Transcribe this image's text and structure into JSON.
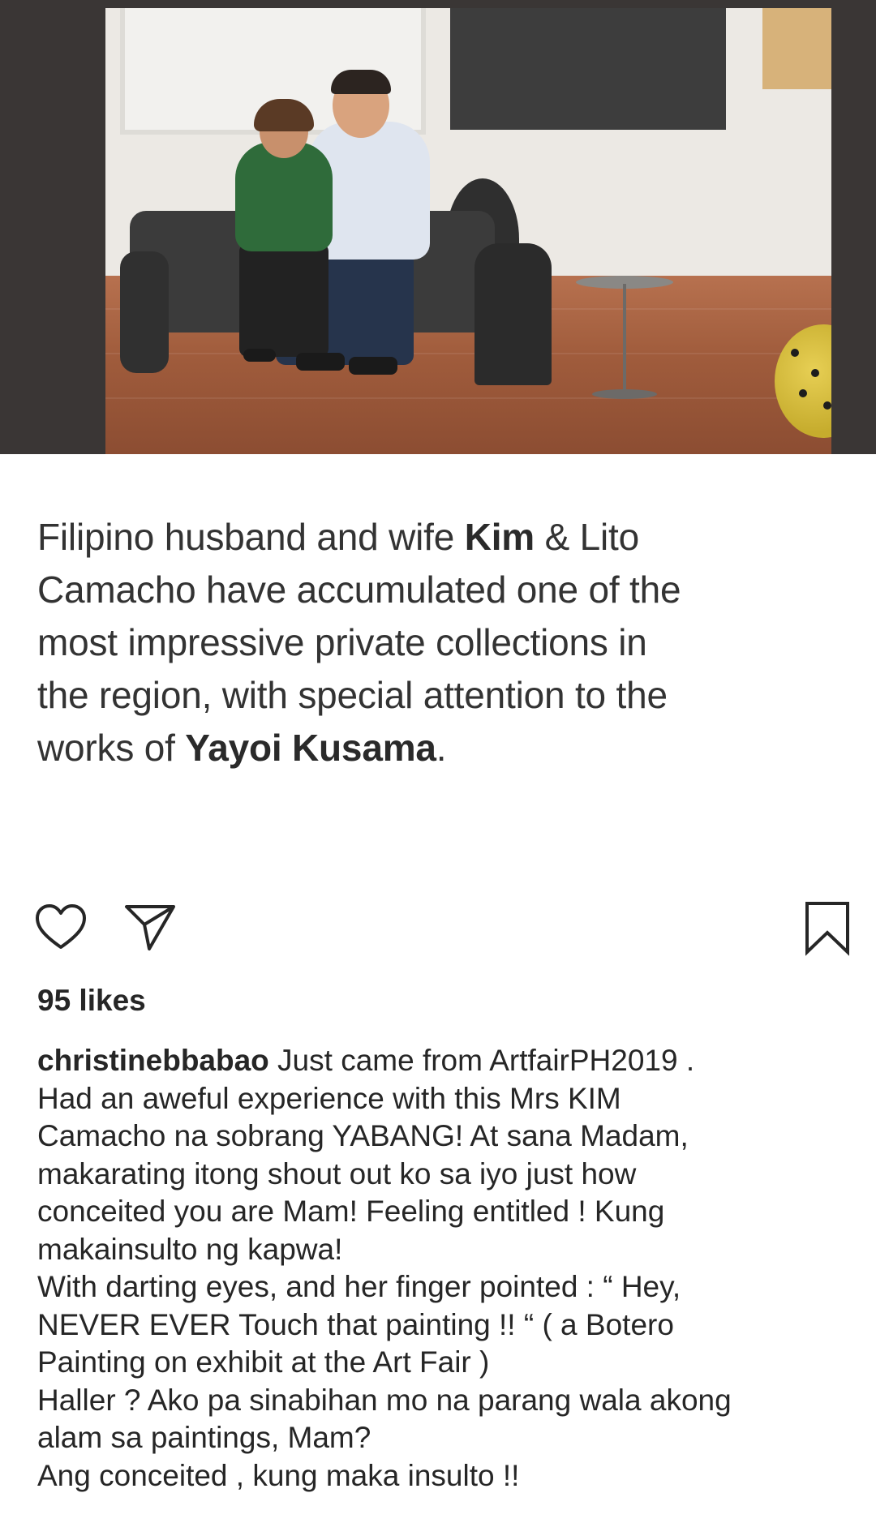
{
  "photo": {
    "alt_subject": "couple-seated-on-sofa"
  },
  "article": {
    "lines": [
      [
        {
          "t": "Filipino husband and wife "
        },
        {
          "t": "Kim",
          "b": true
        },
        {
          "t": " & Lito"
        }
      ],
      [
        {
          "t": "Camacho have accumulated one of the"
        }
      ],
      [
        {
          "t": "most impressive private collections in"
        }
      ],
      [
        {
          "t": "the region, with special attention to the"
        }
      ],
      [
        {
          "t": "works of "
        },
        {
          "t": "Yayoi Kusama",
          "b": true
        },
        {
          "t": "."
        }
      ]
    ]
  },
  "actions": {
    "like_icon": "heart-outline-icon",
    "share_icon": "paper-plane-icon",
    "save_icon": "bookmark-outline-icon"
  },
  "likes": {
    "text": "95 likes"
  },
  "caption": {
    "username": "christinebbabao",
    "first_line_rest": " Just came from ArtfairPH2019 .",
    "lines": [
      "Had an aweful experience with this Mrs KIM",
      "Camacho na sobrang YABANG! At sana Madam,",
      "makarating itong shout out ko sa iyo just how",
      "conceited you are Mam! Feeling entitled ! Kung",
      "makainsulto ng kapwa!",
      "With darting eyes, and her finger pointed : “ Hey,",
      "NEVER EVER Touch that painting !! “ ( a Botero",
      "Painting on exhibit at the Art Fair )",
      "Haller ? Ako pa sinabihan mo na parang wala akong",
      "alam sa paintings, Mam?",
      "Ang conceited , kung maka insulto !!"
    ]
  },
  "colors": {
    "text": "#262626",
    "article_text": "#333333",
    "icon_stroke": "#262626",
    "photo_frame": "#3a3635"
  }
}
